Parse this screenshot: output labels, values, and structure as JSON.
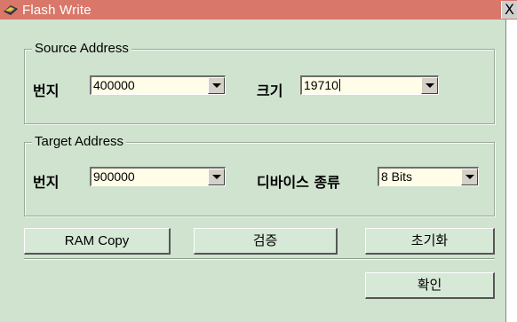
{
  "window": {
    "title": "Flash Write",
    "close_glyph": "X",
    "title_icon": "flash-chip-icon",
    "titlebar_color": "#d9786a",
    "background_color": "#cfe3cf"
  },
  "source": {
    "legend": "Source Address",
    "address_label": "번지",
    "address_value": "400000",
    "size_label": "크기",
    "size_value": "19710"
  },
  "target": {
    "legend": "Target Address",
    "address_label": "번지",
    "address_value": "900000",
    "device_label": "디바이스 종류",
    "device_value": "8 Bits"
  },
  "buttons": {
    "ram_copy": "RAM Copy",
    "verify": "검증",
    "init": "초기화",
    "ok": "확인"
  }
}
